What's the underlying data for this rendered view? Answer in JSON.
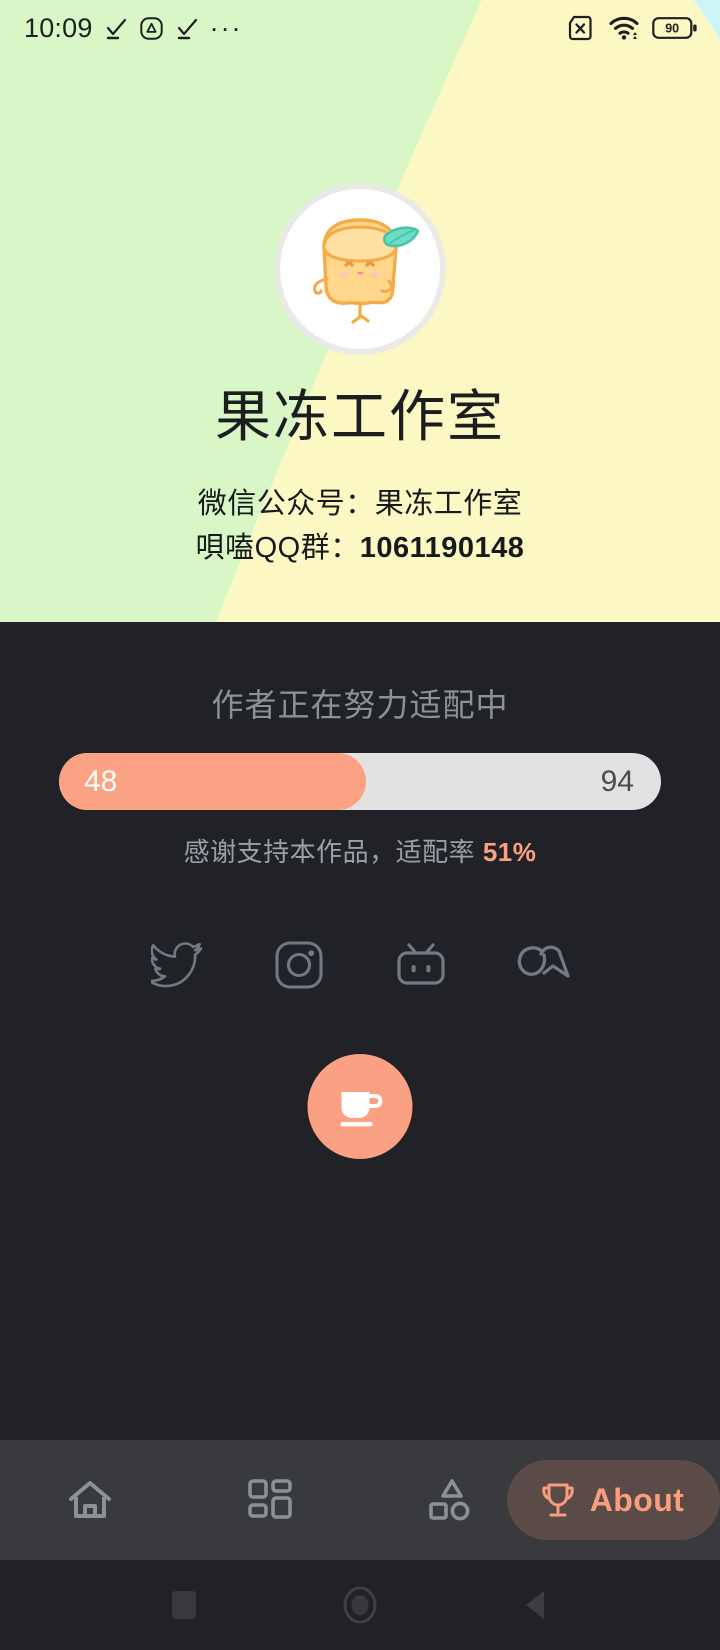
{
  "status_bar": {
    "time": "10:09",
    "left_icons": [
      "check-mark-icon",
      "triangle-alert-icon",
      "check-mark-icon",
      "more-dots-icon"
    ],
    "overflow_dots": "···",
    "right_icons": [
      "no-sim-icon",
      "wifi-icon",
      "battery-icon"
    ],
    "battery_level": "90"
  },
  "header": {
    "avatar_icon": "jelly-pudding-avatar",
    "title": "果冻工作室",
    "line1": "微信公众号：果冻工作室",
    "line2_label": "唄嗑QQ群：",
    "line2_value": "1061190148",
    "band_green": "#d9f7c6",
    "band_yellow": "#fbf8c4",
    "band_cyan": "#cdf7f7"
  },
  "adaptation": {
    "title": "作者正在努力适配中",
    "current": "48",
    "total": "94",
    "percent_fill": 51,
    "thanks_prefix": "感谢支持本作品，适配率 ",
    "rate": "51%",
    "accent_color": "#fba284",
    "track_color": "#e2e2e2"
  },
  "socials": [
    {
      "name": "twitter-icon",
      "label": "Twitter"
    },
    {
      "name": "instagram-icon",
      "label": "Instagram"
    },
    {
      "name": "bilibili-icon",
      "label": "Bilibili"
    },
    {
      "name": "coolapk-icon",
      "label": "Coolapk"
    }
  ],
  "donate": {
    "icon": "coffee-cup-icon",
    "color": "#fba183"
  },
  "bottom_nav": {
    "items": [
      {
        "name": "nav-home",
        "icon": "home-icon"
      },
      {
        "name": "nav-dashboard",
        "icon": "grid-dashboard-icon"
      },
      {
        "name": "nav-shapes",
        "icon": "shapes-icon"
      },
      {
        "name": "nav-wallpaper",
        "icon": "wallpaper-cards-icon"
      }
    ],
    "about": {
      "icon": "trophy-icon",
      "label": "About",
      "pill_color": "#5b4b47",
      "text_color": "#fa9d7e"
    }
  },
  "system_nav": {
    "recents_icon": "square-recents-icon",
    "home_icon": "circle-home-icon",
    "back_icon": "triangle-back-icon"
  }
}
